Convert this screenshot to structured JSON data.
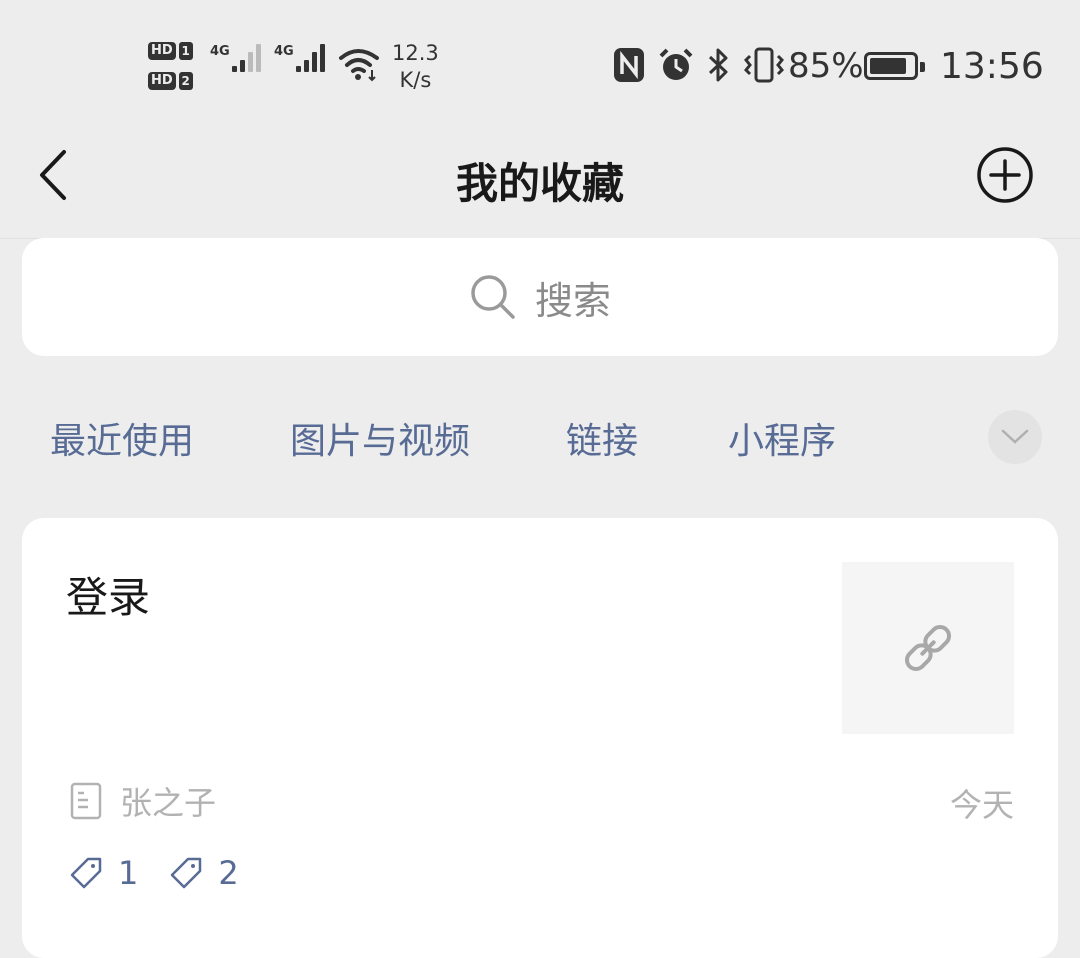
{
  "status_bar": {
    "sim1_label": "HD",
    "sim1_num": "1",
    "sim2_label": "HD",
    "sim2_num": "2",
    "signal1_type": "4G",
    "signal2_type": "4G",
    "net_speed_value": "12.3",
    "net_speed_unit": "K/s",
    "icons": [
      "nfc-icon",
      "alarm-icon",
      "bluetooth-icon",
      "vibrate-icon"
    ],
    "battery_percent": "85%",
    "battery_level": 0.85,
    "time": "13:56"
  },
  "nav": {
    "title": "我的收藏",
    "back_icon": "chevron-left-icon",
    "add_icon": "plus-circle-icon"
  },
  "search": {
    "placeholder": "搜索",
    "icon": "search-icon"
  },
  "categories": {
    "items": [
      "最近使用",
      "图片与视频",
      "链接",
      "小程序"
    ],
    "expand_icon": "chevron-down-icon"
  },
  "favorites": [
    {
      "title": "登录",
      "thumbnail_icon": "link-icon",
      "source": "张之子",
      "date": "今天",
      "tags": [
        "1",
        "2"
      ]
    }
  ],
  "colors": {
    "background": "#ededed",
    "card": "#ffffff",
    "accent_text": "#576b95",
    "secondary_text": "#b2b2b2"
  }
}
